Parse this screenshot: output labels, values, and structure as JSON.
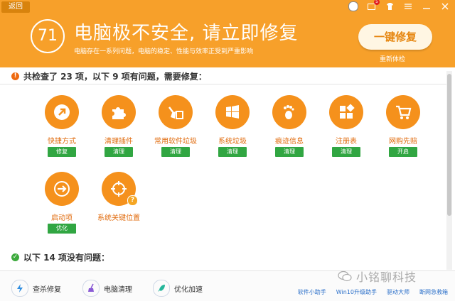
{
  "titlebar": {
    "back_label": "返回",
    "badge_count": "5"
  },
  "header": {
    "score": "71",
    "headline": "电脑极不安全, 请立即修复",
    "subline": "电脑存在一系列问题，电脑的稳定、性能与效率正受到严重影响",
    "fix_button": "一键修复",
    "recheck_link": "重新体检",
    "accent_color": "#f7a02a"
  },
  "summary_problems": "共检查了 23 项，以下 9 项有问题，需要修复：",
  "problem_items": [
    {
      "label": "快捷方式",
      "action": "修复",
      "icon": "shortcut-arrow-icon"
    },
    {
      "label": "清理插件",
      "action": "清理",
      "icon": "puzzle-icon"
    },
    {
      "label": "常用软件垃圾",
      "action": "清理",
      "icon": "broom-bucket-icon"
    },
    {
      "label": "系统垃圾",
      "action": "清理",
      "icon": "windows-logo-icon"
    },
    {
      "label": "痕迹信息",
      "action": "清理",
      "icon": "footprint-icon"
    },
    {
      "label": "注册表",
      "action": "清理",
      "icon": "registry-blocks-icon"
    },
    {
      "label": "网购先赔",
      "action": "开启",
      "icon": "shopping-cart-icon"
    },
    {
      "label": "启动项",
      "action": "优化",
      "icon": "startup-arrow-icon"
    },
    {
      "label": "系统关键位置",
      "action": "",
      "icon": "crosshair-icon"
    }
  ],
  "summary_ok": "以下 14 项没有问题：",
  "bottom_tools": [
    {
      "label": "查杀修复",
      "icon": "lightning-shield-icon"
    },
    {
      "label": "电脑清理",
      "icon": "broom-icon"
    },
    {
      "label": "优化加速",
      "icon": "rocket-icon"
    }
  ],
  "bottom_links": [
    "软件小助手",
    "Win10升级助手",
    "驱动大师",
    "断网急救箱"
  ],
  "watermark": "小铭聊科技"
}
